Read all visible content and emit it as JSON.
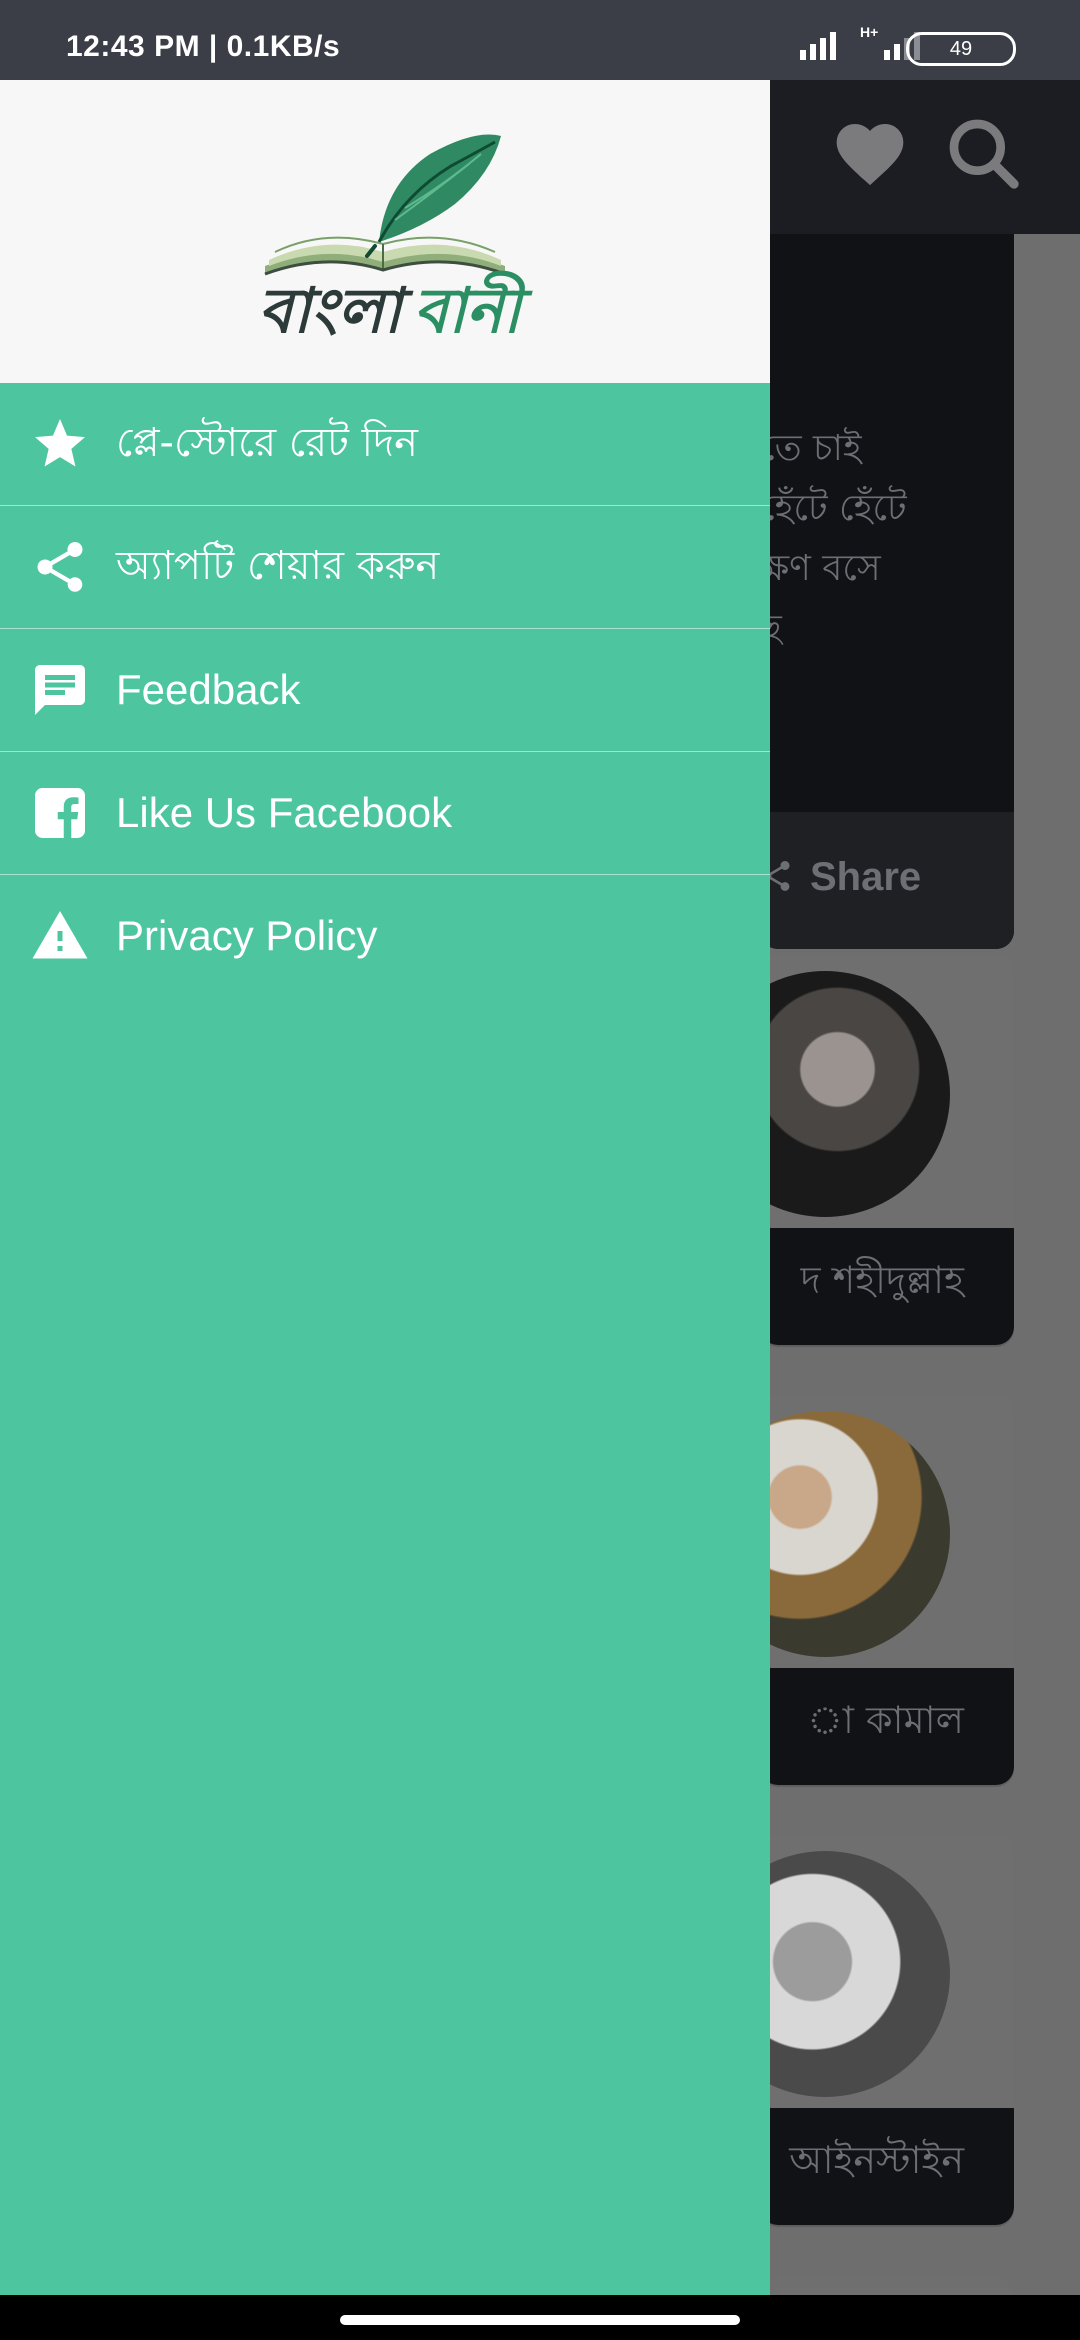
{
  "status_bar": {
    "time_speed": "12:43 PM | 0.1KB/s",
    "network_label": "H+",
    "battery": "49"
  },
  "background": {
    "quote_text": "তে চাই\nহেঁটে হেঁটে\nক্ষণ বসে\nছ",
    "share_label": "Share",
    "authors": [
      {
        "name": "দ শহীদুল্লাহ"
      },
      {
        "name": "া কামাল"
      },
      {
        "name": " আইনস্টাইন"
      }
    ]
  },
  "drawer": {
    "logo": {
      "word1": "বাংলা",
      "word2": "বানী"
    },
    "menu": [
      {
        "label": "প্লে-স্টোরে রেট দিন",
        "icon": "star-icon"
      },
      {
        "label": "অ্যাপটি শেয়ার করুন",
        "icon": "share-icon"
      },
      {
        "label": "Feedback",
        "icon": "feedback-icon"
      },
      {
        "label": "Like Us Facebook",
        "icon": "facebook-icon"
      },
      {
        "label": "Privacy Policy",
        "icon": "warning-icon"
      }
    ]
  },
  "colors": {
    "drawer_bg": "#4dc69f",
    "header_bg": "#f7f7f7",
    "logo_green": "#2b8f63",
    "status_bar": "#3b3e46"
  }
}
